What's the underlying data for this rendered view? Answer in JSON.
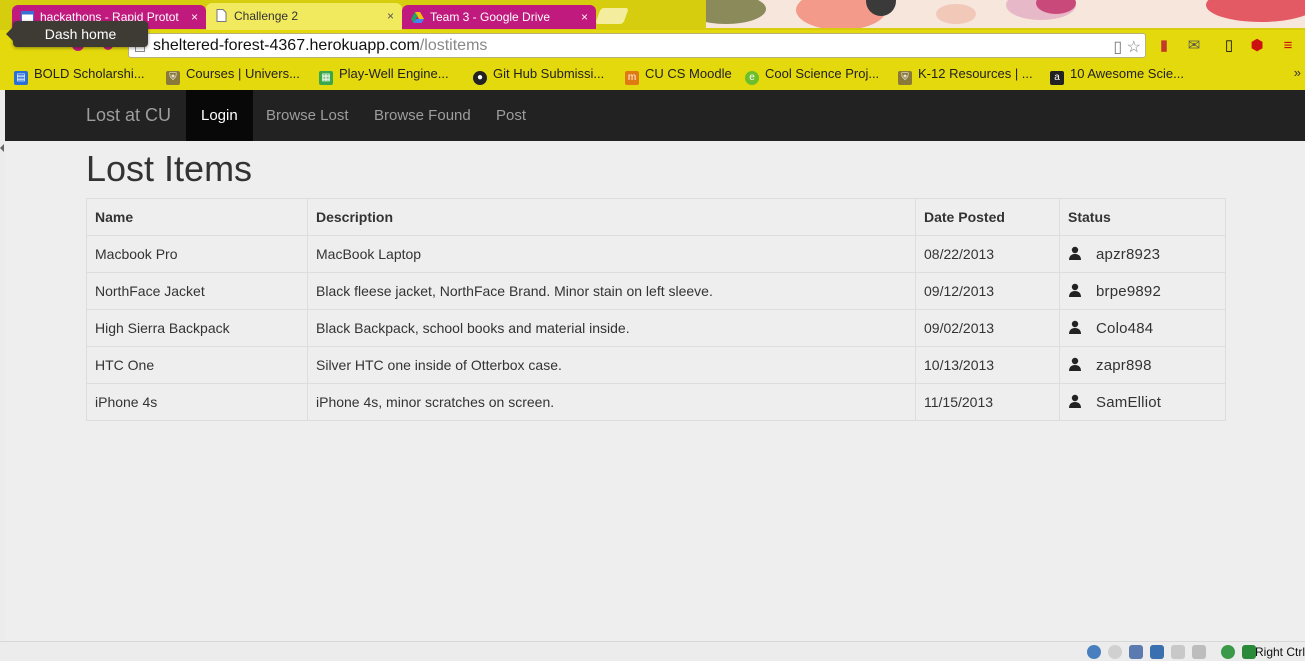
{
  "browser": {
    "tabs": [
      {
        "title": "hackathons - Rapid Protot",
        "close": "×"
      },
      {
        "title": "Challenge 2",
        "close": "×"
      },
      {
        "title": "Team 3 - Google Drive",
        "close": "×"
      }
    ],
    "tooltip": "Dash home",
    "url_host": "sheltered-forest-4367.herokuapp.com",
    "url_path": "/lostitems",
    "bookmarks": [
      {
        "label": "BOLD Scholarshi...",
        "icon": "document-icon",
        "color": "#2a6fd6"
      },
      {
        "label": "Courses | Univers...",
        "icon": "shield-icon",
        "color": "#8a7a3a"
      },
      {
        "label": "Play-Well Engine...",
        "icon": "spreadsheet-icon",
        "color": "#3aa84a"
      },
      {
        "label": "Git Hub Submissi...",
        "icon": "github-icon",
        "color": "#222222"
      },
      {
        "label": "CU CS Moodle",
        "icon": "moodle-icon",
        "color": "#e07a12"
      },
      {
        "label": "Cool Science Proj...",
        "icon": "e-icon",
        "color": "#6cbf2a"
      },
      {
        "label": "K-12 Resources | ...",
        "icon": "shield-icon",
        "color": "#8a7a3a"
      },
      {
        "label": "10 Awesome Scie...",
        "icon": "amazon-icon",
        "color": "#222222"
      }
    ],
    "bookmarks_more": "»"
  },
  "navbar": {
    "brand": "Lost at CU",
    "items": [
      {
        "label": "Login",
        "active": true
      },
      {
        "label": "Browse Lost",
        "active": false
      },
      {
        "label": "Browse Found",
        "active": false
      },
      {
        "label": "Post",
        "active": false
      }
    ]
  },
  "page": {
    "title": "Lost Items",
    "table": {
      "headers": [
        "Name",
        "Description",
        "Date Posted",
        "Status"
      ],
      "rows": [
        {
          "name": "Macbook Pro",
          "description": "MacBook Laptop",
          "date": "08/22/2013",
          "status": "apzr8923"
        },
        {
          "name": "NorthFace Jacket",
          "description": "Black fleese jacket, NorthFace Brand. Minor stain on left sleeve.",
          "date": "09/12/2013",
          "status": "brpe9892"
        },
        {
          "name": "High Sierra Backpack",
          "description": "Black Backpack, school books and material inside.",
          "date": "09/02/2013",
          "status": "Colo484"
        },
        {
          "name": "HTC One",
          "description": "Silver HTC one inside of Otterbox case.",
          "date": "10/13/2013",
          "status": "zapr898"
        },
        {
          "name": "iPhone 4s",
          "description": "iPhone 4s, minor scratches on screen.",
          "date": "11/15/2013",
          "status": "SamElliot"
        }
      ]
    }
  },
  "statusbar": {
    "host_key": "Right Ctrl"
  },
  "colors": {
    "chrome_yellow": "#e4d90c",
    "tab_magenta": "#c11a7e",
    "navbar_bg": "#222222",
    "navbar_active": "#080808"
  }
}
